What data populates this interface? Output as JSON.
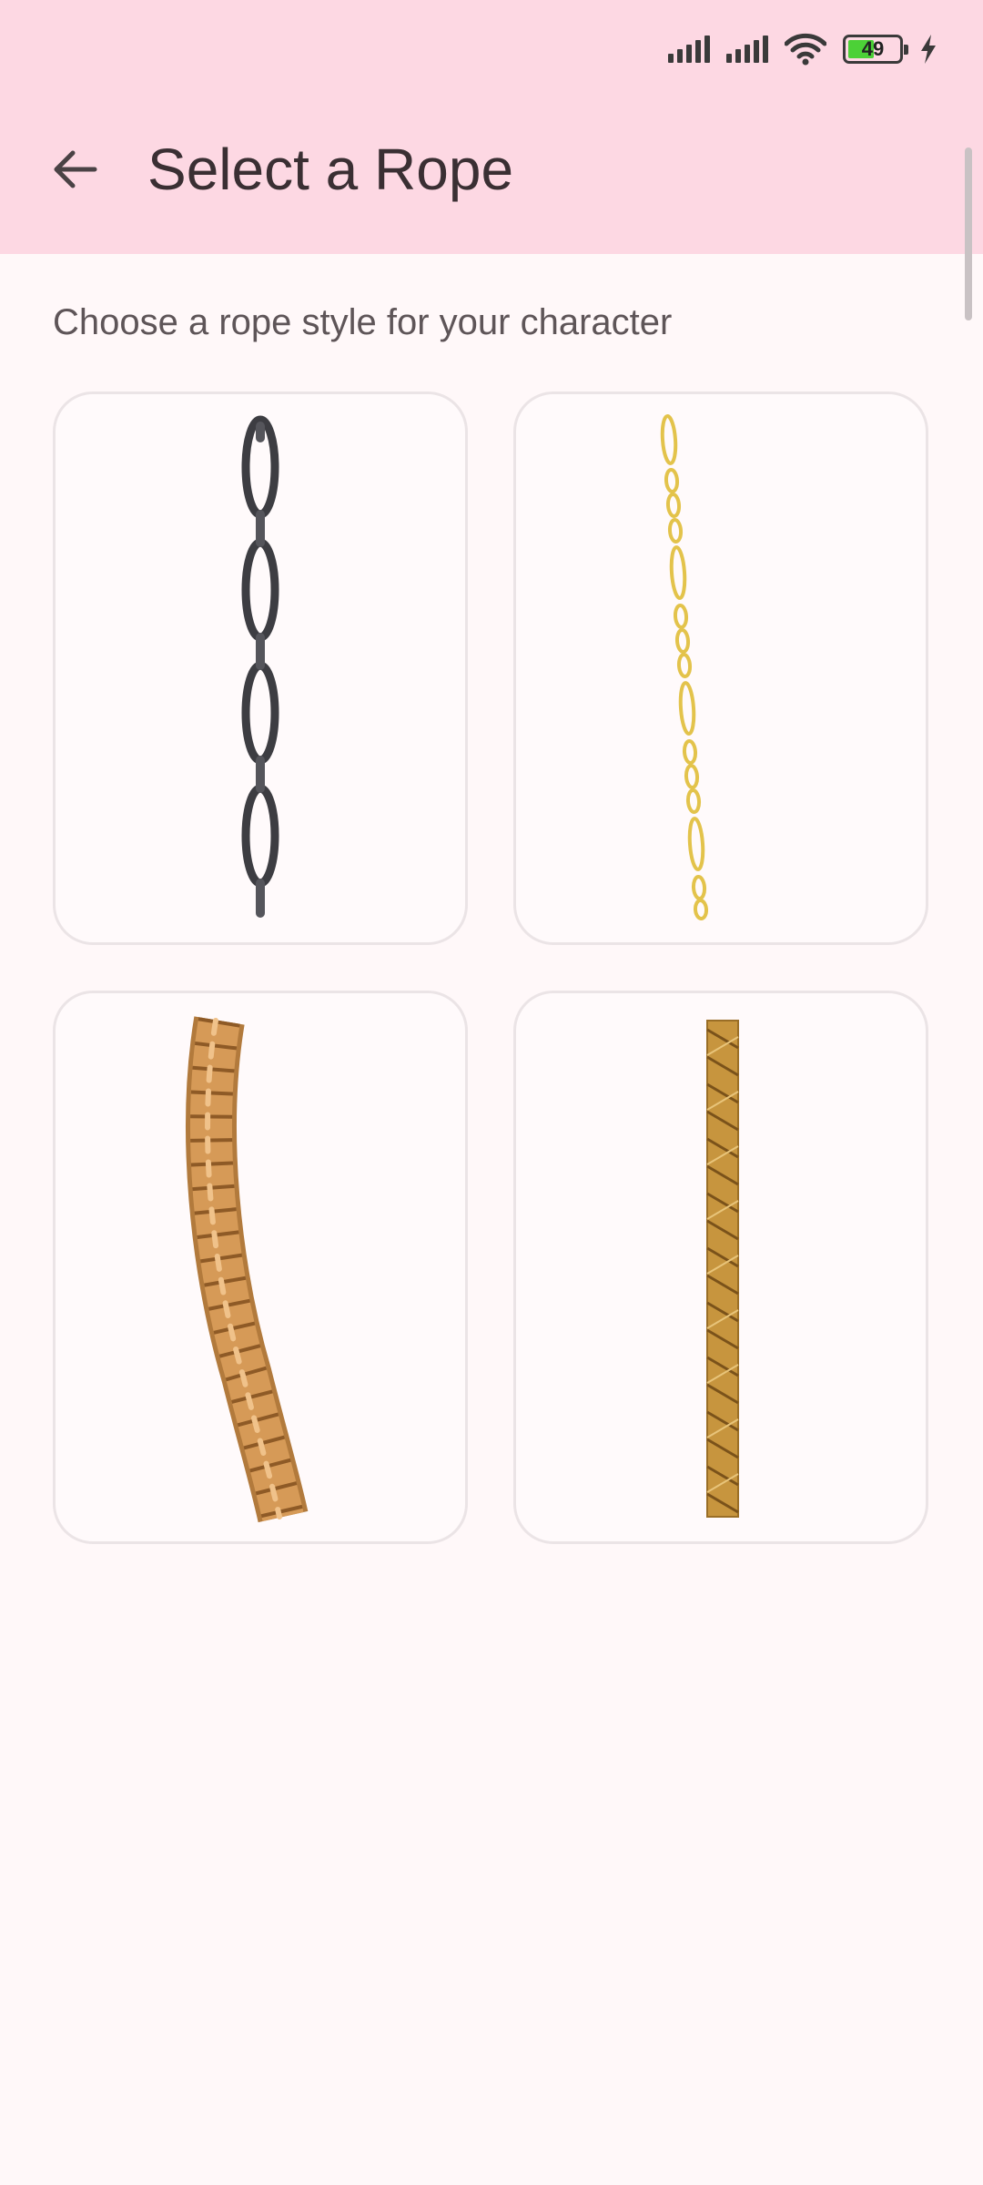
{
  "status_bar": {
    "battery_level": "49",
    "icons": [
      "signal-icon",
      "signal-icon",
      "wifi-icon",
      "battery-icon",
      "charging-icon"
    ]
  },
  "header": {
    "title": "Select a Rope",
    "back_icon": "back-arrow-icon"
  },
  "main": {
    "subtitle": "Choose a rope style for your character",
    "ropes": [
      {
        "style": "dark-chain",
        "color": "#3d3d42"
      },
      {
        "style": "gold-figaro-chain",
        "color": "#e3c34b"
      },
      {
        "style": "twisted-hemp-rope",
        "color": "#d69a57"
      },
      {
        "style": "braided-gold-rope",
        "color": "#c7953e"
      }
    ]
  },
  "colors": {
    "header_bg": "#fdd8e3",
    "page_bg": "#fff8f9",
    "card_border": "#ebe4e6",
    "title_text": "#3a2f33"
  }
}
